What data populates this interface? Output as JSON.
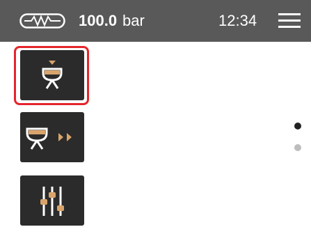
{
  "status_bar": {
    "pressure_value": "100.0",
    "pressure_unit": "bar",
    "clock": "12:34",
    "pressure_icon": "pressure-gauge-icon",
    "menu_icon": "hamburger-menu-icon"
  },
  "tiles": [
    {
      "icon": "single-shot-brew-icon",
      "selected": true
    },
    {
      "icon": "continuous-brew-icon",
      "selected": false
    },
    {
      "icon": "settings-sliders-icon",
      "selected": false
    }
  ],
  "pager": {
    "page_count": 2,
    "active_page": 1
  },
  "colors": {
    "status_bar": "#595959",
    "tile": "#2b2b2b",
    "accent": "#d8a46b",
    "selection": "#e5242b",
    "dot_active": "#222222",
    "dot_inactive": "#bdbdbd"
  }
}
